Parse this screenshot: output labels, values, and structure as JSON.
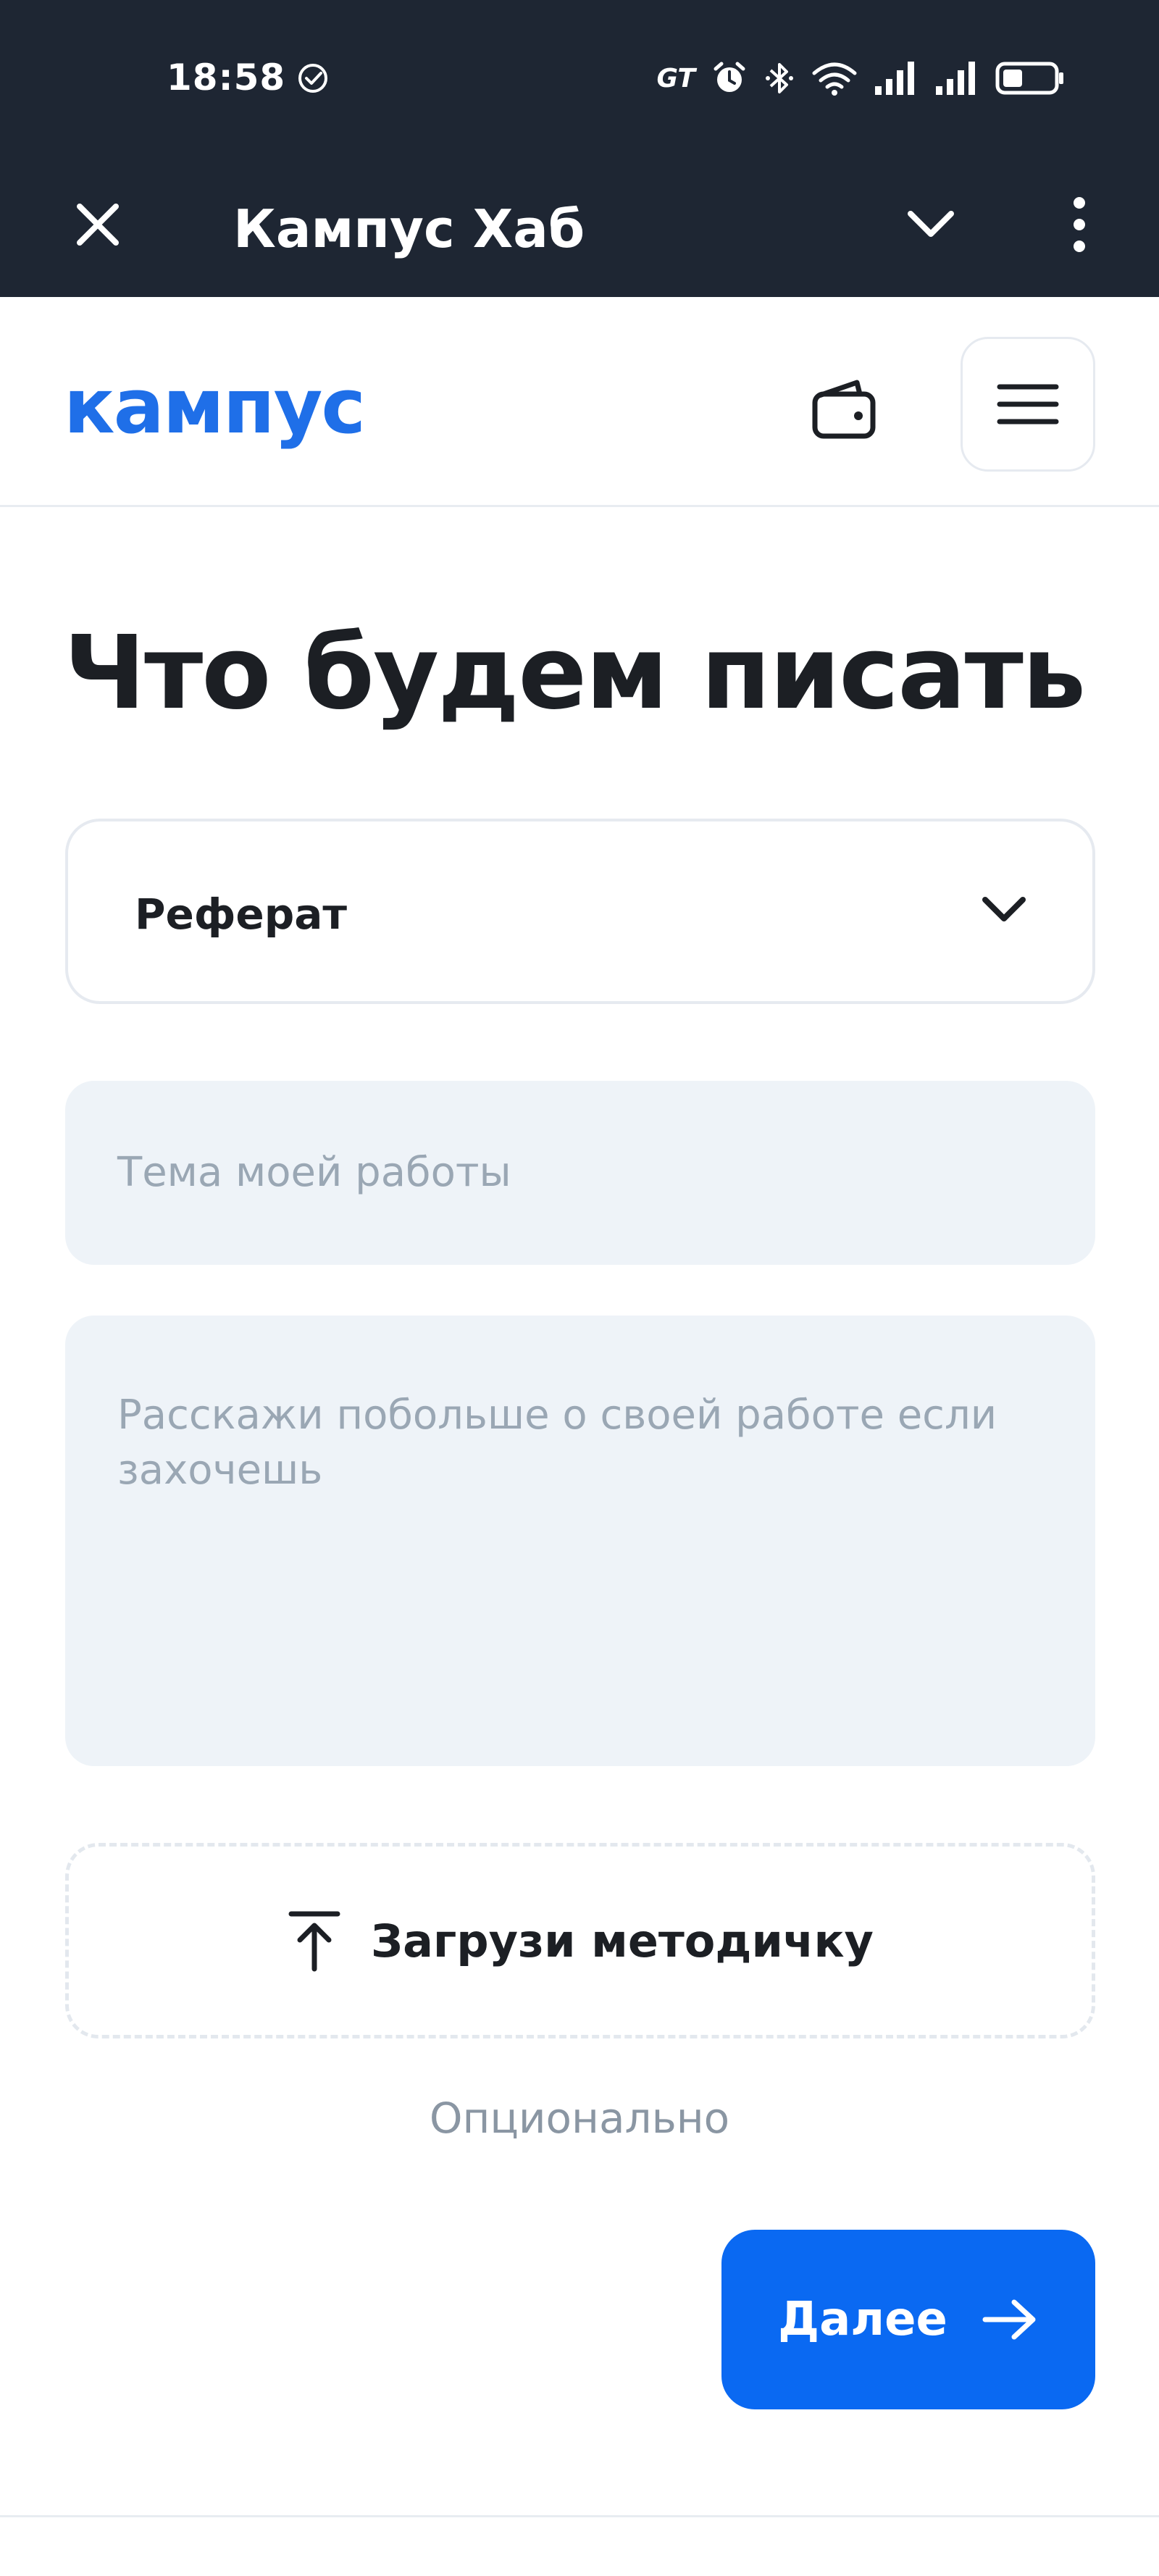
{
  "status_bar": {
    "time": "18:58",
    "carrier_tag": "GT",
    "icons": [
      "check-circle-icon",
      "alarm-icon",
      "bluetooth-icon",
      "wifi-icon",
      "signal-icon",
      "signal-icon",
      "battery-icon"
    ]
  },
  "app_bar": {
    "title": "Кампус Хаб"
  },
  "header": {
    "logo": "кампус",
    "brand_color": "#1f6fe8"
  },
  "form": {
    "title": "Что будем писать",
    "type_select": {
      "value": "Реферат"
    },
    "topic_input": {
      "placeholder": "Тема моей работы"
    },
    "details_textarea": {
      "placeholder": "Расскажи побольше о своей работе если захочешь"
    },
    "upload": {
      "label": "Загрузи методичку",
      "hint": "Опционально"
    },
    "next_button": {
      "label": "Далее",
      "color": "#0a69f2"
    }
  }
}
